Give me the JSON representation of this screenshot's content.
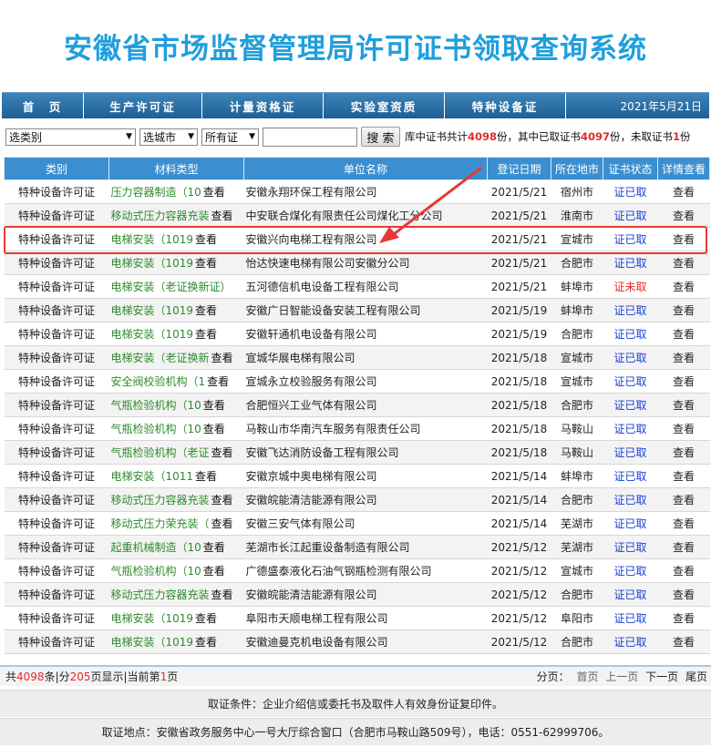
{
  "header": {
    "title": "安徽省市场监督管理局许可证书领取查询系统"
  },
  "nav": {
    "items": [
      "首　页",
      "生产许可证",
      "计量资格证",
      "实验室资质",
      "特种设备证"
    ],
    "date": "2021年5月21日"
  },
  "filters": {
    "category": "选类别",
    "city": "选城市",
    "status": "所有证",
    "search_value": "",
    "search_button": "搜 索",
    "stats": {
      "prefix": "库中证书共计",
      "total": "4098",
      "mid": "份，其中已取证书",
      "taken": "4097",
      "mid2": "份，未取证书",
      "untaken": "1",
      "suffix": "份"
    }
  },
  "table": {
    "headers": [
      "类别",
      "材料类型",
      "单位名称",
      "登记日期",
      "所在地市",
      "证书状态",
      "详情查看"
    ],
    "rows": [
      {
        "type": "特种设备许可证",
        "material": "压力容器制造（10",
        "view": "查看",
        "unit": "安徽永翔环保工程有限公司",
        "date": "2021/5/21",
        "city": "宿州市",
        "status": "证已取",
        "detail": "查看"
      },
      {
        "type": "特种设备许可证",
        "material": "移动式压力容器充装",
        "view": "查看",
        "unit": "中安联合煤化有限责任公司煤化工分公司",
        "date": "2021/5/21",
        "city": "淮南市",
        "status": "证已取",
        "detail": "查看"
      },
      {
        "type": "特种设备许可证",
        "material": "电梯安装（1019",
        "view": "查看",
        "unit": "安徽兴向电梯工程有限公司",
        "date": "2021/5/21",
        "city": "宣城市",
        "status": "证已取",
        "detail": "查看"
      },
      {
        "type": "特种设备许可证",
        "material": "电梯安装（1019",
        "view": "查看",
        "unit": "怡达快速电梯有限公司安徽分公司",
        "date": "2021/5/21",
        "city": "合肥市",
        "status": "证已取",
        "detail": "查看"
      },
      {
        "type": "特种设备许可证",
        "material": "电梯安装（老证换新证）",
        "view": "",
        "unit": "五河德信机电设备工程有限公司",
        "date": "2021/5/21",
        "city": "蚌埠市",
        "status": "证未取",
        "detail": "查看"
      },
      {
        "type": "特种设备许可证",
        "material": "电梯安装（1019",
        "view": "查看",
        "unit": "安徽广日智能设备安装工程有限公司",
        "date": "2021/5/19",
        "city": "蚌埠市",
        "status": "证已取",
        "detail": "查看"
      },
      {
        "type": "特种设备许可证",
        "material": "电梯安装（1019",
        "view": "查看",
        "unit": "安徽轩通机电设备有限公司",
        "date": "2021/5/19",
        "city": "合肥市",
        "status": "证已取",
        "detail": "查看"
      },
      {
        "type": "特种设备许可证",
        "material": "电梯安装（老证换新",
        "view": "查看",
        "unit": "宣城华展电梯有限公司",
        "date": "2021/5/18",
        "city": "宣城市",
        "status": "证已取",
        "detail": "查看"
      },
      {
        "type": "特种设备许可证",
        "material": "安全阀校验机构（1",
        "view": "查看",
        "unit": "宣城永立校验服务有限公司",
        "date": "2021/5/18",
        "city": "宣城市",
        "status": "证已取",
        "detail": "查看"
      },
      {
        "type": "特种设备许可证",
        "material": "气瓶检验机构（10",
        "view": "查看",
        "unit": "合肥恒兴工业气体有限公司",
        "date": "2021/5/18",
        "city": "合肥市",
        "status": "证已取",
        "detail": "查看"
      },
      {
        "type": "特种设备许可证",
        "material": "气瓶检验机构（10",
        "view": "查看",
        "unit": "马鞍山市华南汽车服务有限责任公司",
        "date": "2021/5/18",
        "city": "马鞍山",
        "status": "证已取",
        "detail": "查看"
      },
      {
        "type": "特种设备许可证",
        "material": "气瓶检验机构（老证",
        "view": "查看",
        "unit": "安徽飞达消防设备工程有限公司",
        "date": "2021/5/18",
        "city": "马鞍山",
        "status": "证已取",
        "detail": "查看"
      },
      {
        "type": "特种设备许可证",
        "material": "电梯安装（1011",
        "view": "查看",
        "unit": "安徽京城中奥电梯有限公司",
        "date": "2021/5/14",
        "city": "蚌埠市",
        "status": "证已取",
        "detail": "查看"
      },
      {
        "type": "特种设备许可证",
        "material": "移动式压力容器充装",
        "view": "查看",
        "unit": "安徽皖能清洁能源有限公司",
        "date": "2021/5/14",
        "city": "合肥市",
        "status": "证已取",
        "detail": "查看"
      },
      {
        "type": "特种设备许可证",
        "material": "移动式压力荣充装（",
        "view": "查看",
        "unit": "安徽三安气体有限公司",
        "date": "2021/5/14",
        "city": "芜湖市",
        "status": "证已取",
        "detail": "查看"
      },
      {
        "type": "特种设备许可证",
        "material": "起重机械制造（10",
        "view": "查看",
        "unit": "芜湖市长江起重设备制造有限公司",
        "date": "2021/5/12",
        "city": "芜湖市",
        "status": "证已取",
        "detail": "查看"
      },
      {
        "type": "特种设备许可证",
        "material": "气瓶检验机构（10",
        "view": "查看",
        "unit": "广德盛泰液化石油气钢瓶检测有限公司",
        "date": "2021/5/12",
        "city": "宣城市",
        "status": "证已取",
        "detail": "查看"
      },
      {
        "type": "特种设备许可证",
        "material": "移动式压力容器充装",
        "view": "查看",
        "unit": "安徽皖能清洁能源有限公司",
        "date": "2021/5/12",
        "city": "合肥市",
        "status": "证已取",
        "detail": "查看"
      },
      {
        "type": "特种设备许可证",
        "material": "电梯安装（1019",
        "view": "查看",
        "unit": "阜阳市天顺电梯工程有限公司",
        "date": "2021/5/12",
        "city": "阜阳市",
        "status": "证已取",
        "detail": "查看"
      },
      {
        "type": "特种设备许可证",
        "material": "电梯安装（1019",
        "view": "查看",
        "unit": "安徽迪曼克机电设备有限公司",
        "date": "2021/5/12",
        "city": "合肥市",
        "status": "证已取",
        "detail": "查看"
      }
    ]
  },
  "pager": {
    "summary": {
      "p1": "共",
      "total": "4098",
      "p2": "条|分",
      "pages": "205",
      "p3": "页显示|当前第",
      "current": "1",
      "p4": "页"
    },
    "label": "分页：",
    "links": [
      "首页",
      "上一页",
      "下一页",
      "尾页"
    ]
  },
  "footer": {
    "condition": "取证条件：企业介绍信或委托书及取件人有效身份证复印件。",
    "location": "取证地点：安徽省政务服务中心一号大厅综合窗口（合肥市马鞍山路509号），电话：0551-62999706。"
  },
  "colors": {
    "nav": "#1d5f95",
    "header_row": "#3b8fd0",
    "title": "#1f9fdc",
    "material": "#2e8b2e",
    "taken": "#1a3fd6",
    "untaken": "#e32b2b",
    "highlight": "#e53935"
  },
  "annotation": {
    "highlighted_row": 3
  }
}
